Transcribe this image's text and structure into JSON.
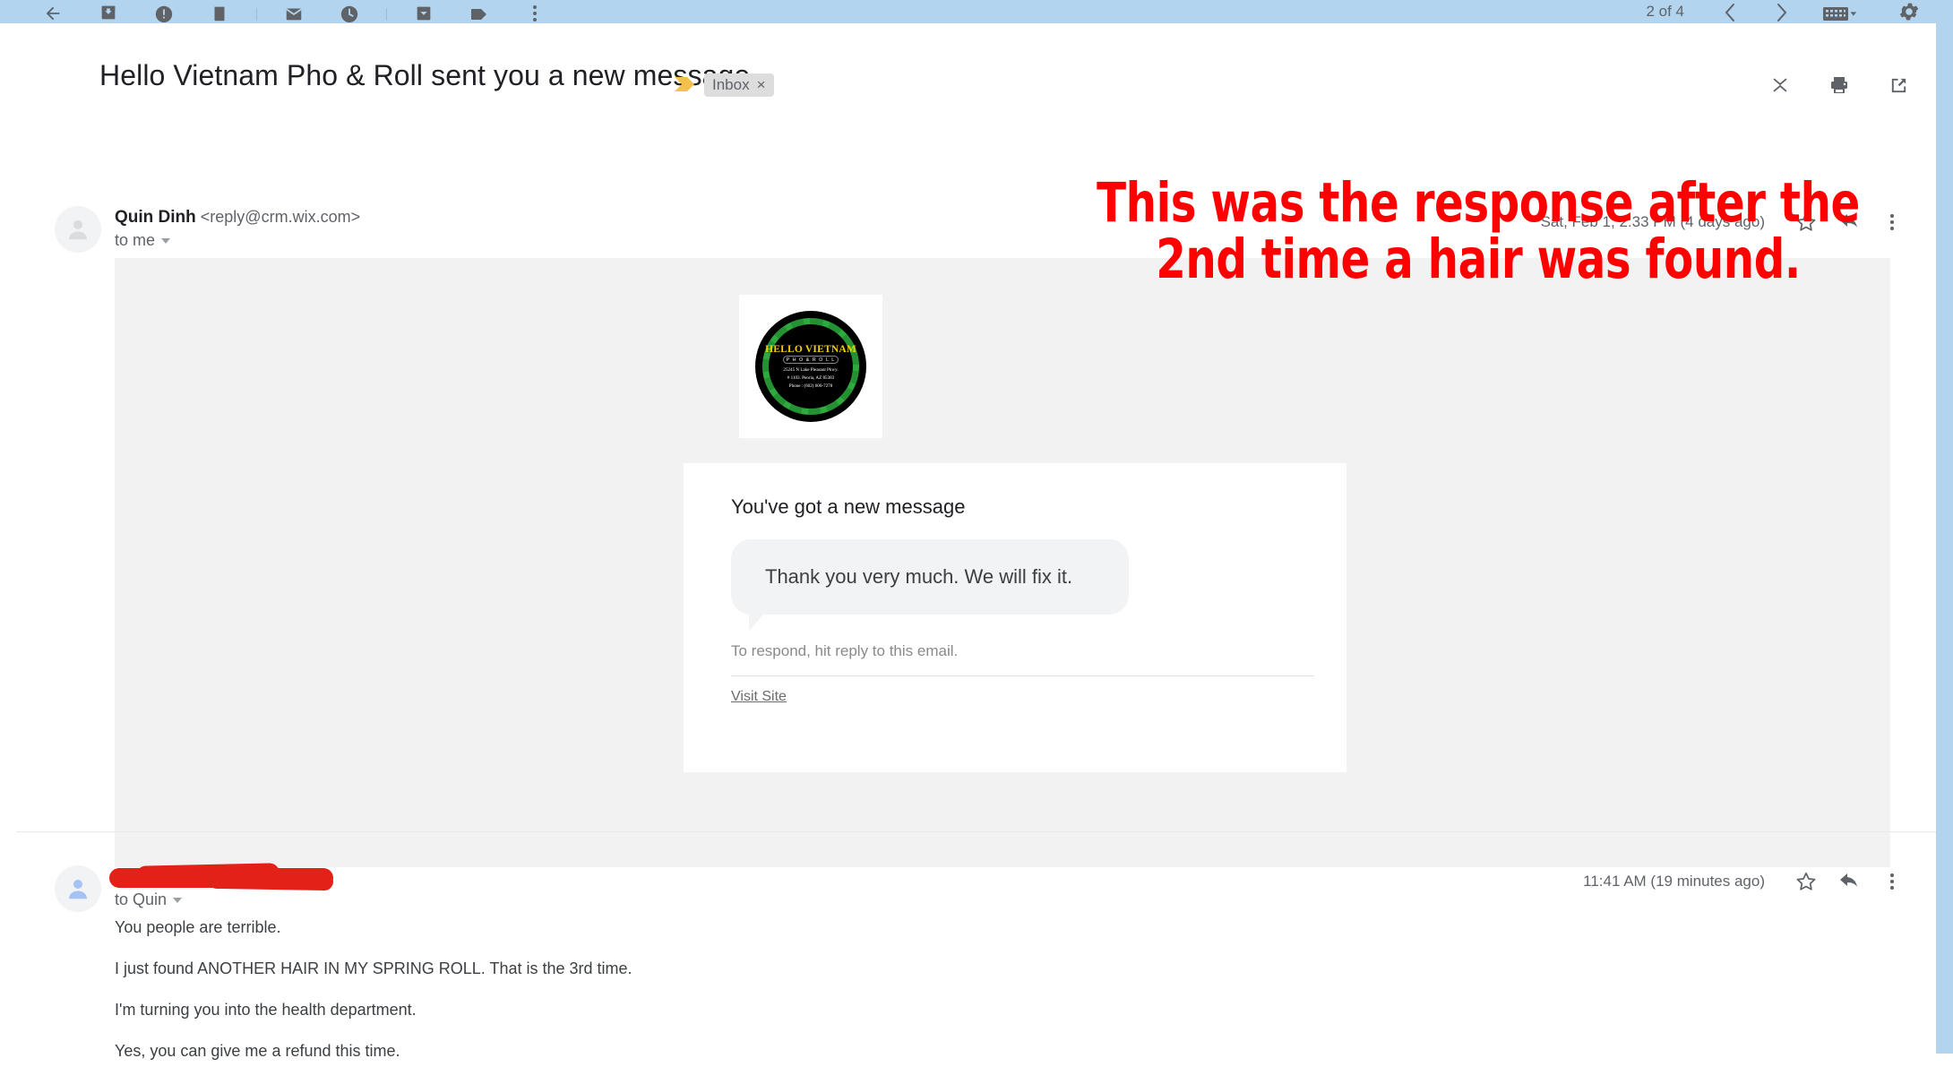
{
  "toolbar": {
    "back_icon": "back-arrow-icon",
    "archive_icon": "archive-icon",
    "spam_icon": "report-spam-icon",
    "delete_icon": "delete-trash-icon",
    "unread_icon": "mark-unread-icon",
    "snooze_icon": "snooze-clock-icon",
    "move_icon": "move-to-icon",
    "label_icon": "label-tag-icon",
    "more_icon": "more-options-icon",
    "count": "2 of 4",
    "prev_icon": "previous-chevron-icon",
    "next_icon": "next-chevron-icon",
    "keyboard_icon": "keyboard-input-icon",
    "keyboard_caret_icon": "chevron-down-icon",
    "settings_icon": "gear-icon"
  },
  "subject": {
    "text": "Hello Vietnam Pho & Roll sent you a new message",
    "importance_marker_icon": "importance-chevron-icon",
    "label": "Inbox",
    "label_remove_icon": "×",
    "collapse_icon": "collapse-all-icon",
    "print_icon": "print-icon",
    "popout_icon": "open-in-new-window-icon"
  },
  "message1": {
    "avatar_icon": "default-avatar-icon",
    "sender_name": "Quin Dinh",
    "sender_email": "<reply@crm.wix.com>",
    "recipient": "to me",
    "recipient_caret_icon": "chevron-down-icon",
    "timestamp": "Sat, Feb 1, 2:33 PM (4 days ago)",
    "star_icon": "star-outline-icon",
    "reply_icon": "reply-arrow-icon",
    "more_icon": "more-options-icon",
    "logo": {
      "title": "HELLO VIETNAM",
      "subtitle": "P H O & R O L L",
      "address_line1": "25245 N Lake Pleasant Pkwy.",
      "address_line2": "# 1103. Peoria, AZ 85383",
      "phone": "Phone : (602) 600-7278"
    },
    "card": {
      "title": "You've got a new message",
      "bubble_text": "Thank you very much. We will fix it.",
      "respond_note": "To respond, hit reply to this email.",
      "link_label": "Visit Site"
    }
  },
  "annotation": {
    "text": "This was the response after the 2nd time a hair was found.",
    "color": "#fe0000"
  },
  "message2": {
    "avatar_icon": "default-avatar-icon",
    "sender_redacted": "",
    "recipient": "to Quin",
    "recipient_caret_icon": "chevron-down-icon",
    "timestamp": "11:41 AM (19 minutes ago)",
    "star_icon": "star-outline-icon",
    "reply_icon": "reply-arrow-icon",
    "more_icon": "more-options-icon",
    "body": [
      "You people are terrible.",
      "I just found ANOTHER HAIR IN MY SPRING ROLL. That is the 3rd time.",
      "I'm turning you into the health department.",
      "Yes, you can give me a refund this time."
    ]
  }
}
